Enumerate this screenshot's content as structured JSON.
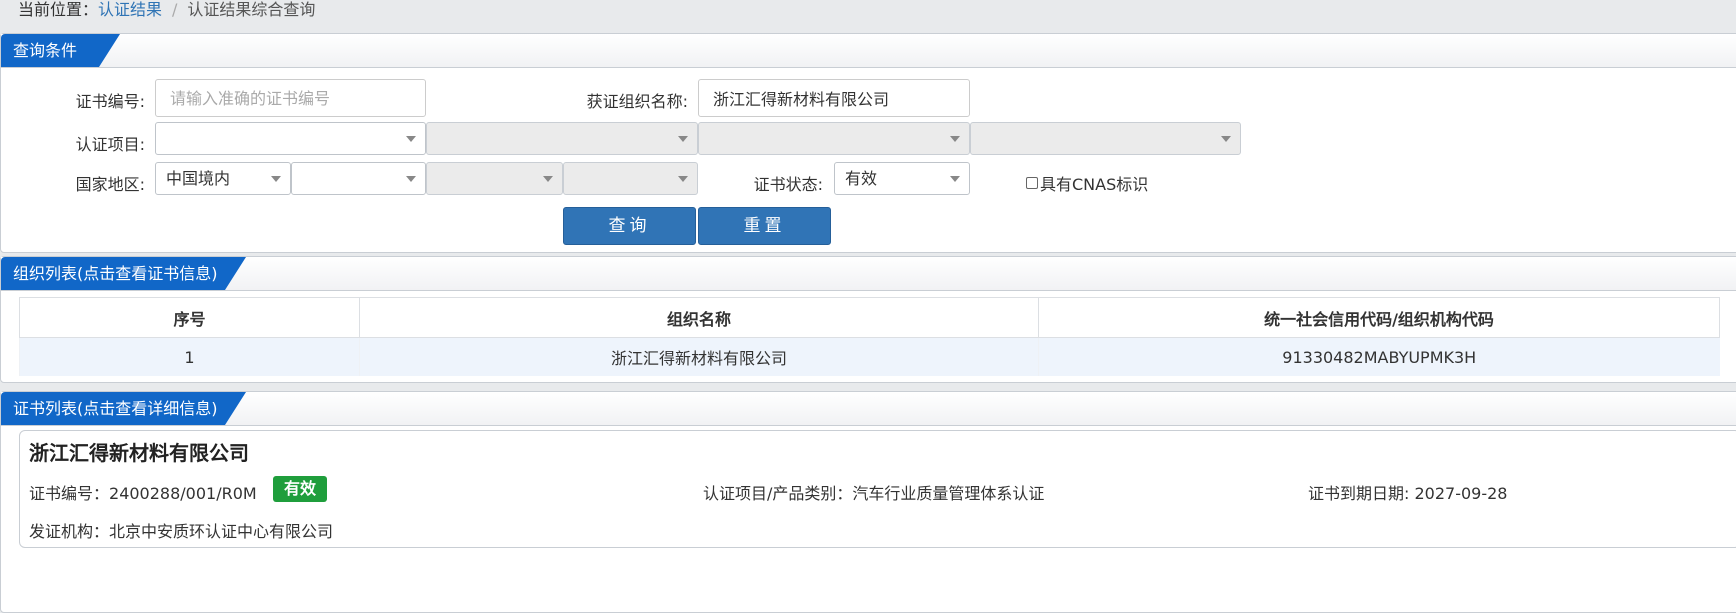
{
  "breadcrumb": {
    "prefix": "当前位置：",
    "link": "认证结果",
    "separator": "/",
    "current": "认证结果综合查询"
  },
  "query_panel": {
    "tab": "查询条件",
    "cert_no_label": "证书编号:",
    "cert_no_placeholder": "请输入准确的证书编号",
    "cert_no_value": "",
    "org_name_label": "获证组织名称:",
    "org_name_value": "浙江汇得新材料有限公司",
    "cert_item_label": "认证项目:",
    "cert_item_selects": [
      "",
      "",
      "",
      ""
    ],
    "region_label": "国家地区:",
    "region_selects": [
      "中国境内",
      "",
      "",
      ""
    ],
    "status_label": "证书状态:",
    "status_value": "有效",
    "cnas_label": "具有CNAS标识",
    "search_button": "查询",
    "reset_button": "重置"
  },
  "org_panel": {
    "tab": "组织列表(点击查看证书信息)",
    "columns": [
      "序号",
      "组织名称",
      "统一社会信用代码/组织机构代码"
    ],
    "rows": [
      [
        "1",
        "浙江汇得新材料有限公司",
        "91330482MABYUPMK3H"
      ]
    ]
  },
  "cert_panel": {
    "tab": "证书列表(点击查看详细信息)",
    "card": {
      "org_name": "浙江汇得新材料有限公司",
      "cert_no_label": "证书编号：",
      "cert_no": "2400288/001/R0M",
      "status_badge": "有效",
      "item_label": "认证项目/产品类别：",
      "item": "汽车行业质量管理体系认证",
      "expiry_label": "证书到期日期: ",
      "expiry": "2027-09-28",
      "issuer_label": "发证机构：",
      "issuer": "北京中安质环认证中心有限公司"
    }
  },
  "colors": {
    "tab_blue": "#1167c8",
    "button_blue": "#3074b6",
    "badge_green": "#1f9e3c",
    "link_blue": "#2f74b5"
  },
  "icons": {
    "dropdown": "chevron-down-icon",
    "checkbox": "checkbox-icon"
  }
}
